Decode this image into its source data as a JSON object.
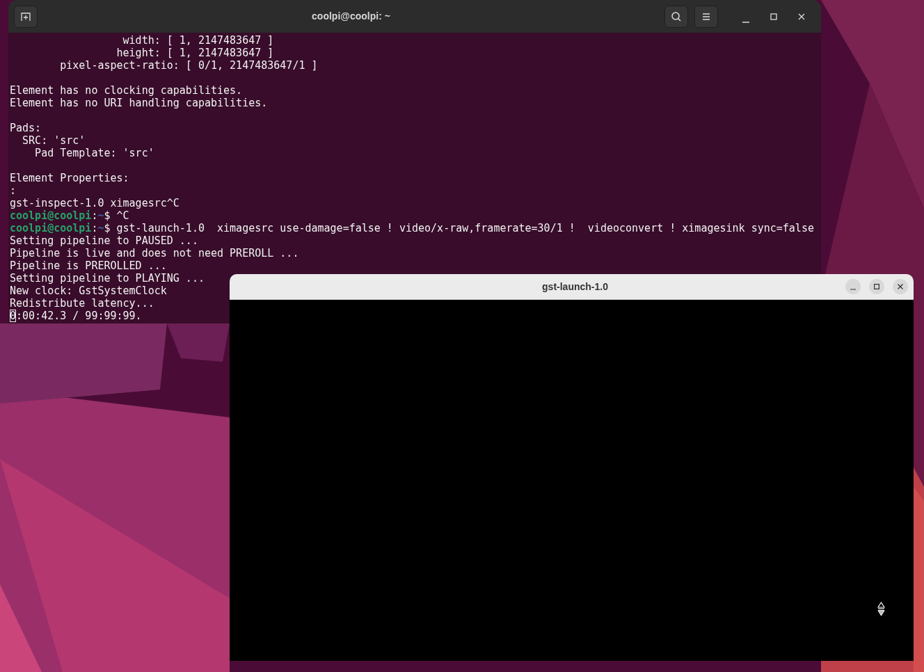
{
  "terminal": {
    "title": "coolpi@coolpi: ~",
    "lines": [
      {
        "kind": "output",
        "text": "                  width: [ 1, 2147483647 ]",
        "cursor": false
      },
      {
        "kind": "output",
        "text": "                 height: [ 1, 2147483647 ]",
        "cursor": false
      },
      {
        "kind": "output",
        "text": "        pixel-aspect-ratio: [ 0/1, 2147483647/1 ]",
        "cursor": false
      },
      {
        "kind": "blank"
      },
      {
        "kind": "output",
        "text": "Element has no clocking capabilities.",
        "cursor": false
      },
      {
        "kind": "output",
        "text": "Element has no URI handling capabilities.",
        "cursor": false
      },
      {
        "kind": "blank"
      },
      {
        "kind": "output",
        "text": "Pads:",
        "cursor": false
      },
      {
        "kind": "output",
        "text": "  SRC: 'src'",
        "cursor": false
      },
      {
        "kind": "output",
        "text": "    Pad Template: 'src'",
        "cursor": false
      },
      {
        "kind": "blank"
      },
      {
        "kind": "output",
        "text": "Element Properties:",
        "cursor": false
      },
      {
        "kind": "output",
        "text": ":",
        "cursor": false
      },
      {
        "kind": "output",
        "text": "gst-inspect-1.0 ximagesrc^C",
        "cursor": false
      },
      {
        "kind": "prompt",
        "user": "coolpi@coolpi",
        "sep": ":",
        "path": "~",
        "command": "$ ^C"
      },
      {
        "kind": "prompt",
        "user": "coolpi@coolpi",
        "sep": ":",
        "path": "~",
        "command": "$ gst-launch-1.0  ximagesrc use-damage=false ! video/x-raw,framerate=30/1 !  videoconvert ! ximagesink sync=false"
      },
      {
        "kind": "output",
        "text": "Setting pipeline to PAUSED ...",
        "cursor": false
      },
      {
        "kind": "output",
        "text": "Pipeline is live and does not need PREROLL ...",
        "cursor": false
      },
      {
        "kind": "output",
        "text": "Pipeline is PREROLLED ...",
        "cursor": false
      },
      {
        "kind": "output",
        "text": "Setting pipeline to PLAYING ...",
        "cursor": false
      },
      {
        "kind": "output",
        "text": "New clock: GstSystemClock",
        "cursor": false
      },
      {
        "kind": "output",
        "text": "Redistribute latency...",
        "cursor": false
      },
      {
        "kind": "output",
        "text": "0:00:42.3 / 99:99:99.",
        "cursor": true
      }
    ]
  },
  "video_window": {
    "title": "gst-launch-1.0"
  }
}
